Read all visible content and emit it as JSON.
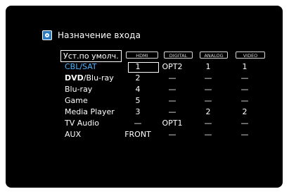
{
  "screen": {
    "title": "Назначение входа",
    "default_label": "Уст.по умолч."
  },
  "columns": [
    "HDMI",
    "DIGITAL",
    "ANALOG",
    "VIDEO"
  ],
  "rows": [
    {
      "label": "CBL/SAT",
      "bold_part": "",
      "rest": "",
      "cells": [
        "1",
        "OPT2",
        "1",
        "1"
      ],
      "selected": true
    },
    {
      "label": "",
      "bold_part": "DVD",
      "rest": "/Blu-ray",
      "cells": [
        "2",
        "—",
        "—",
        "—"
      ],
      "selected": false
    },
    {
      "label": "Blu-ray",
      "bold_part": "",
      "rest": "",
      "cells": [
        "4",
        "—",
        "—",
        "—"
      ],
      "selected": false
    },
    {
      "label": "Game",
      "bold_part": "",
      "rest": "",
      "cells": [
        "5",
        "—",
        "—",
        "—"
      ],
      "selected": false
    },
    {
      "label": "Media Player",
      "bold_part": "",
      "rest": "",
      "cells": [
        "3",
        "—",
        "2",
        "2"
      ],
      "selected": false
    },
    {
      "label": "TV Audio",
      "bold_part": "",
      "rest": "",
      "cells": [
        "—",
        "OPT1",
        "—",
        "—"
      ],
      "selected": false
    },
    {
      "label": "AUX",
      "bold_part": "",
      "rest": "",
      "cells": [
        "FRONT",
        "—",
        "—",
        "—"
      ],
      "selected": false
    }
  ],
  "colors": {
    "selected_text": "#4fb3ff",
    "icon_bg": "#2a7ac0",
    "background": "#000000"
  }
}
